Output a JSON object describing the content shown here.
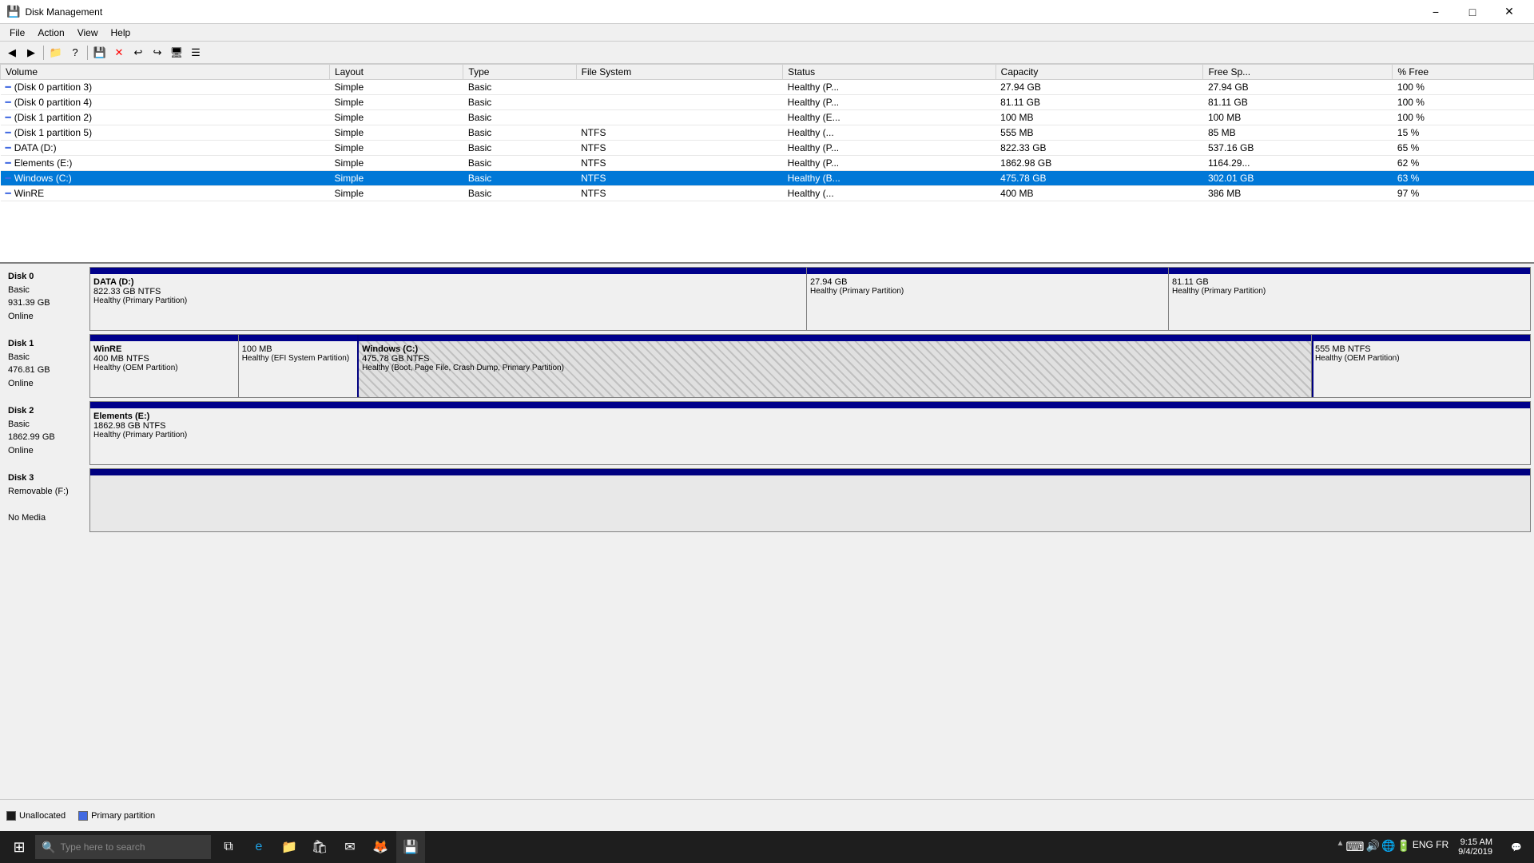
{
  "app": {
    "title": "Disk Management",
    "icon": "💾"
  },
  "menu": {
    "items": [
      "File",
      "Action",
      "View",
      "Help"
    ]
  },
  "toolbar": {
    "buttons": [
      "◀",
      "▶",
      "📁",
      "?",
      "💾",
      "✕",
      "💾",
      "📋",
      "📋",
      "📋",
      "📋"
    ]
  },
  "table": {
    "headers": [
      "Volume",
      "Layout",
      "Type",
      "File System",
      "Status",
      "Capacity",
      "Free Sp...",
      "% Free"
    ],
    "rows": [
      {
        "name": "(Disk 0 partition 3)",
        "layout": "Simple",
        "type": "Basic",
        "fs": "",
        "status": "Healthy (P...",
        "capacity": "27.94 GB",
        "free": "27.94 GB",
        "pct": "100 %",
        "selected": false
      },
      {
        "name": "(Disk 0 partition 4)",
        "layout": "Simple",
        "type": "Basic",
        "fs": "",
        "status": "Healthy (P...",
        "capacity": "81.11 GB",
        "free": "81.11 GB",
        "pct": "100 %",
        "selected": false
      },
      {
        "name": "(Disk 1 partition 2)",
        "layout": "Simple",
        "type": "Basic",
        "fs": "",
        "status": "Healthy (E...",
        "capacity": "100 MB",
        "free": "100 MB",
        "pct": "100 %",
        "selected": false
      },
      {
        "name": "(Disk 1 partition 5)",
        "layout": "Simple",
        "type": "Basic",
        "fs": "NTFS",
        "status": "Healthy (...",
        "capacity": "555 MB",
        "free": "85 MB",
        "pct": "15 %",
        "selected": false
      },
      {
        "name": "DATA (D:)",
        "layout": "Simple",
        "type": "Basic",
        "fs": "NTFS",
        "status": "Healthy (P...",
        "capacity": "822.33 GB",
        "free": "537.16 GB",
        "pct": "65 %",
        "selected": false
      },
      {
        "name": "Elements (E:)",
        "layout": "Simple",
        "type": "Basic",
        "fs": "NTFS",
        "status": "Healthy (P...",
        "capacity": "1862.98 GB",
        "free": "1164.29...",
        "pct": "62 %",
        "selected": false
      },
      {
        "name": "Windows (C:)",
        "layout": "Simple",
        "type": "Basic",
        "fs": "NTFS",
        "status": "Healthy (B...",
        "capacity": "475.78 GB",
        "free": "302.01 GB",
        "pct": "63 %",
        "selected": true
      },
      {
        "name": "WinRE",
        "layout": "Simple",
        "type": "Basic",
        "fs": "NTFS",
        "status": "Healthy (...",
        "capacity": "400 MB",
        "free": "386 MB",
        "pct": "97 %",
        "selected": false
      }
    ]
  },
  "disks": [
    {
      "label": "Disk 0",
      "type": "Basic",
      "size": "931.39 GB",
      "status": "Online",
      "partitions": [
        {
          "name": "DATA  (D:)",
          "size": "822.33 GB NTFS",
          "status": "Healthy (Primary Partition)",
          "flex": 50,
          "type": "normal"
        },
        {
          "name": "",
          "size": "27.94 GB",
          "status": "Healthy (Primary Partition)",
          "flex": 25,
          "type": "normal"
        },
        {
          "name": "",
          "size": "81.11 GB",
          "status": "Healthy (Primary Partition)",
          "flex": 25,
          "type": "normal"
        }
      ]
    },
    {
      "label": "Disk 1",
      "type": "Basic",
      "size": "476.81 GB",
      "status": "Online",
      "partitions": [
        {
          "name": "WinRE",
          "size": "400 MB NTFS",
          "status": "Healthy (OEM Partition)",
          "flex": 10,
          "type": "normal"
        },
        {
          "name": "",
          "size": "100 MB",
          "status": "Healthy (EFI System Partition)",
          "flex": 8,
          "type": "normal"
        },
        {
          "name": "Windows  (C:)",
          "size": "475.78 GB NTFS",
          "status": "Healthy (Boot, Page File, Crash Dump, Primary Partition)",
          "flex": 67,
          "type": "hatched",
          "selected": true
        },
        {
          "name": "",
          "size": "555 MB NTFS",
          "status": "Healthy (OEM Partition)",
          "flex": 15,
          "type": "normal"
        }
      ]
    },
    {
      "label": "Disk 2",
      "type": "Basic",
      "size": "1862.99 GB",
      "status": "Online",
      "partitions": [
        {
          "name": "Elements  (E:)",
          "size": "1862.98 GB NTFS",
          "status": "Healthy (Primary Partition)",
          "flex": 100,
          "type": "normal"
        }
      ]
    },
    {
      "label": "Disk 3",
      "type": "Removable (F:)",
      "size": "",
      "status": "No Media",
      "partitions": []
    }
  ],
  "legend": {
    "items": [
      {
        "type": "unalloc",
        "label": "Unallocated"
      },
      {
        "type": "primary",
        "label": "Primary partition"
      }
    ]
  },
  "taskbar": {
    "search_placeholder": "Type here to search",
    "time": "9:15 AM",
    "date": "9/4/2019",
    "language": "ENG",
    "region": "FR"
  }
}
